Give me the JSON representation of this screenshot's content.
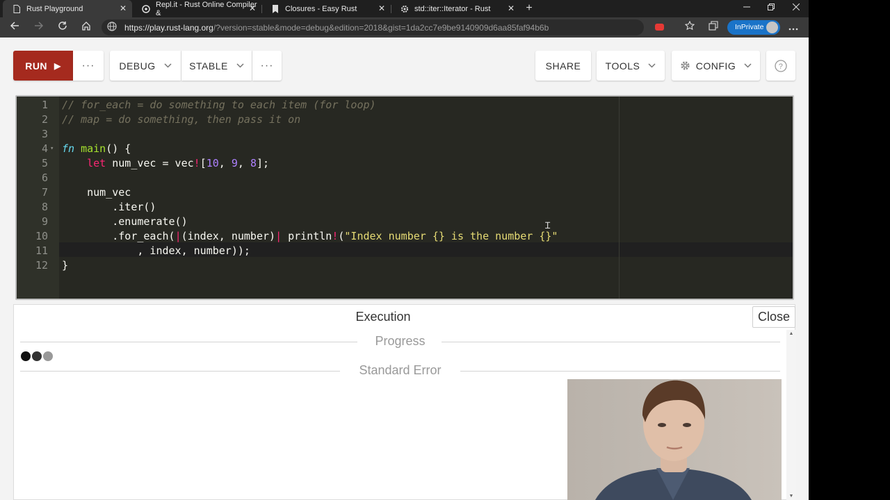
{
  "browser": {
    "tabs": [
      {
        "title": "Rust Playground",
        "icon": "document-icon",
        "active": true
      },
      {
        "title": "Repl.it - Rust Online Compiler &",
        "icon": "replit-icon",
        "active": false
      },
      {
        "title": "Closures - Easy Rust",
        "icon": "bookmark-icon",
        "active": false
      },
      {
        "title": "std::iter::Iterator - Rust",
        "icon": "gear-icon",
        "active": false
      }
    ],
    "close_glyph": "✕",
    "new_tab_glyph": "+",
    "url_host": "https://play.rust-lang.org",
    "url_rest": "/?version=stable&mode=debug&edition=2018&gist=1da2cc7e9be9140909d6aa85faf94b6b",
    "inprivate_label": "InPrivate",
    "accent": "#1a73c8"
  },
  "toolbar": {
    "run_label": "RUN",
    "more_glyph": "···",
    "debug_label": "DEBUG",
    "stable_label": "STABLE",
    "share_label": "SHARE",
    "tools_label": "TOOLS",
    "config_label": "CONFIG",
    "help_glyph": "?",
    "run_color": "#a52a1e"
  },
  "editor": {
    "lines": [
      "// for_each = do something to each item (for loop)",
      "// map = do something, then pass it on",
      "",
      "fn main() {",
      "    let num_vec = vec![10, 9, 8];",
      "",
      "    num_vec",
      "        .iter()",
      "        .enumerate()",
      "        .for_each(|(index, number)| println!(\"Index number {} is the number {}\"",
      "            , index, number));",
      "}"
    ],
    "line_numbers": [
      "1",
      "2",
      "3",
      "4",
      "5",
      "6",
      "7",
      "8",
      "9",
      "10",
      "11",
      "12"
    ]
  },
  "output": {
    "title": "Execution",
    "close_label": "Close",
    "progress_label": "Progress",
    "stderr_label": "Standard Error"
  }
}
